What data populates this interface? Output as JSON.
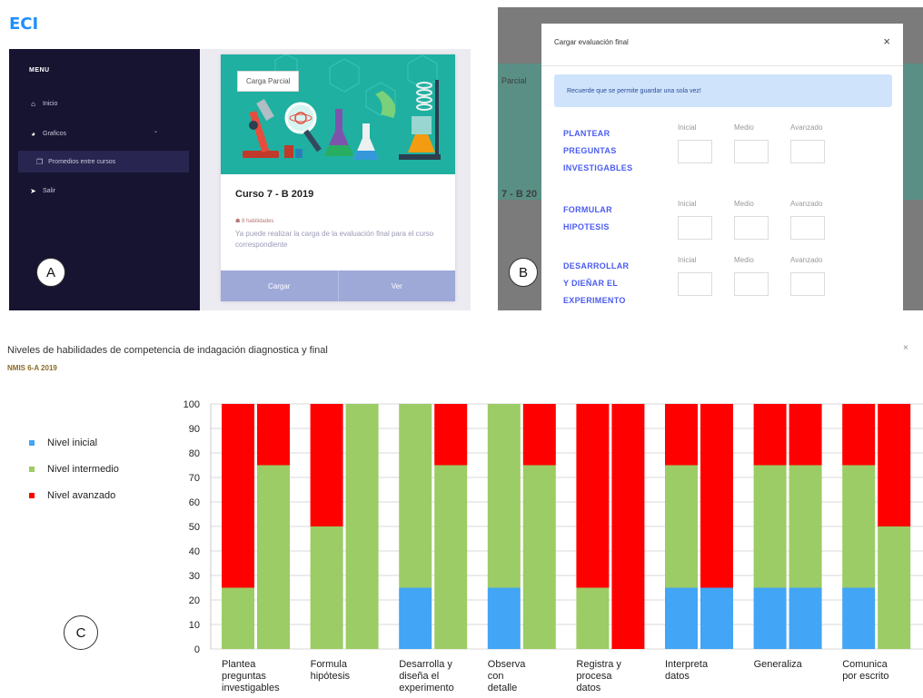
{
  "brand": "ECI",
  "badges": {
    "a": "A",
    "b": "B",
    "c": "C"
  },
  "sidebar": {
    "menu_title": "MENU",
    "items": [
      {
        "label": "Inicio",
        "icon": "home-icon"
      },
      {
        "label": "Graficos",
        "icon": "pie-chart-icon"
      },
      {
        "label": "Promedios entre cursos",
        "icon": "window-icon"
      },
      {
        "label": "Salir",
        "icon": "send-icon"
      }
    ]
  },
  "course_card": {
    "tag": "Carga Parcial",
    "title": "Curso 7 - B 2019",
    "meta": "8 habilidades",
    "description": "Ya puede realizar la carga de la evaluación final para el curso correspondiente",
    "buttons": {
      "upload": "Cargar",
      "view": "Ver"
    }
  },
  "background_fragments": {
    "tag": "Parcial",
    "title": "7 - B 20"
  },
  "modal": {
    "title": "Cargar evaluación final",
    "close": "×",
    "alert": "Recuerde que se permite guardar una sola vez!",
    "levels": [
      "Inicial",
      "Medio",
      "Avanzado"
    ],
    "criteria": [
      {
        "lines": [
          "PLANTEAR",
          "PREGUNTAS",
          "INVESTIGABLES"
        ]
      },
      {
        "lines": [
          "FORMULAR",
          "HIPOTESIS"
        ]
      },
      {
        "lines": [
          "DESARROLLAR",
          "Y DIEÑAR EL",
          "EXPERIMENTO"
        ]
      }
    ]
  },
  "chart_panel": {
    "title": "Niveles de habilidades de competencia de indagación diagnostica y final",
    "subtitle": "NMIS 6-A 2019",
    "close": "×"
  },
  "colors": {
    "inicial": "#42a5f5",
    "intermedio": "#9ccc65",
    "avanzado": "#ff0000"
  },
  "chart_data": {
    "type": "bar",
    "stacked": true,
    "ylim": [
      0,
      100
    ],
    "yticks": [
      0,
      10,
      20,
      30,
      40,
      50,
      60,
      70,
      80,
      90,
      100
    ],
    "legend_position": "left",
    "categories": [
      [
        "Plantea",
        "preguntas",
        "investigables"
      ],
      [
        "Formula",
        "hipótesis"
      ],
      [
        "Desarrolla y",
        "diseña el",
        "experimento"
      ],
      [
        "Observa",
        "con",
        "detalle"
      ],
      [
        "Registra y",
        "procesa",
        "datos"
      ],
      [
        "Interpreta",
        "datos"
      ],
      [
        "Generaliza"
      ],
      [
        "Comunica",
        "por escrito"
      ]
    ],
    "series": [
      {
        "name": "Nivel inicial",
        "values": [
          [
            0,
            0
          ],
          [
            0,
            0
          ],
          [
            25,
            0
          ],
          [
            25,
            0
          ],
          [
            0,
            0
          ],
          [
            25,
            25
          ],
          [
            25,
            25
          ],
          [
            25,
            0
          ]
        ]
      },
      {
        "name": "Nivel intermedio",
        "values": [
          [
            25,
            75
          ],
          [
            50,
            100
          ],
          [
            75,
            75
          ],
          [
            75,
            75
          ],
          [
            25,
            0
          ],
          [
            50,
            0
          ],
          [
            50,
            50
          ],
          [
            50,
            50
          ]
        ]
      },
      {
        "name": "Nivel avanzado",
        "values": [
          [
            75,
            25
          ],
          [
            50,
            0
          ],
          [
            0,
            25
          ],
          [
            0,
            25
          ],
          [
            75,
            100
          ],
          [
            25,
            75
          ],
          [
            25,
            25
          ],
          [
            25,
            50
          ]
        ]
      }
    ]
  }
}
